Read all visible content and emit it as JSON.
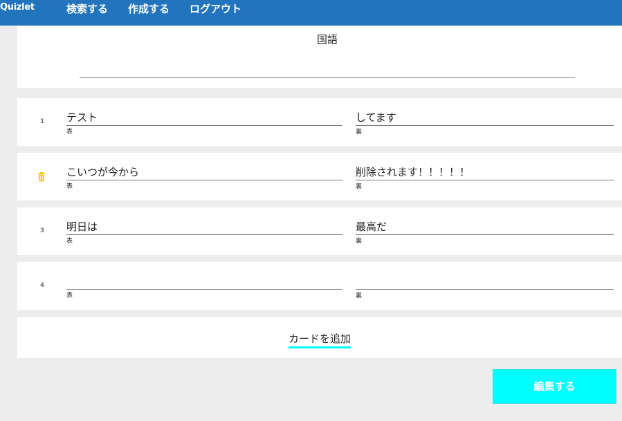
{
  "header": {
    "brand": "Quizlet",
    "nav": [
      "検索する",
      "作成する",
      "ログアウト"
    ]
  },
  "set": {
    "title": "国語"
  },
  "cards": [
    {
      "number": "1",
      "front": "テスト",
      "back": "してます",
      "front_label": "表",
      "back_label": "裏",
      "icon": null
    },
    {
      "number": "",
      "front": "こいつが今から",
      "back": "削除されます！！！！！",
      "front_label": "表",
      "back_label": "裏",
      "icon": "trash-icon"
    },
    {
      "number": "3",
      "front": "明日は",
      "back": "最高だ",
      "front_label": "表",
      "back_label": "裏",
      "icon": null
    },
    {
      "number": "4",
      "front": "",
      "back": "",
      "front_label": "表",
      "back_label": "裏",
      "icon": null
    }
  ],
  "add_card_label": "カードを追加",
  "edit_button_label": "編集する",
  "colors": {
    "header_bg": "#2275bd",
    "accent": "#00ffff",
    "trash_icon": "#f2c200",
    "page_bg": "#ededed"
  }
}
